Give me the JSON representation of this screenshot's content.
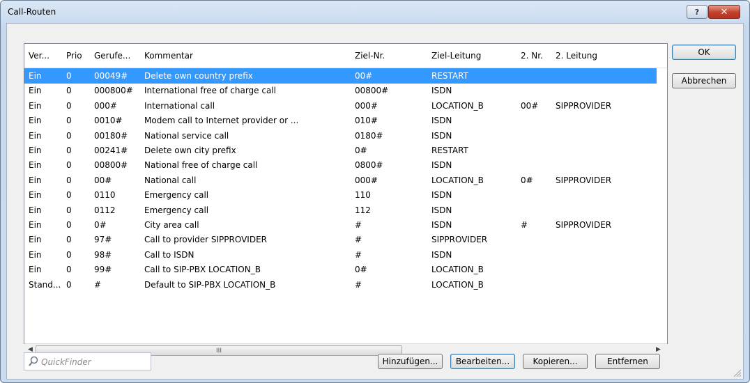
{
  "window": {
    "title": "Call-Routen",
    "help_label": "?",
    "close_label": "✕"
  },
  "columns": [
    "Ver...",
    "Prio",
    "Gerufe...",
    "Kommentar",
    "Ziel-Nr.",
    "Ziel-Leitung",
    "2. Nr.",
    "2. Leitung"
  ],
  "rows": [
    [
      "Ein",
      "0",
      "00049#",
      "Delete own country prefix",
      "00#",
      "RESTART",
      "",
      ""
    ],
    [
      "Ein",
      "0",
      "000800#",
      "International free of charge call",
      "00800#",
      "ISDN",
      "",
      ""
    ],
    [
      "Ein",
      "0",
      "000#",
      "International call",
      "000#",
      "LOCATION_B",
      "00#",
      "SIPPROVIDER"
    ],
    [
      "Ein",
      "0",
      "0010#",
      "Modem call to Internet provider or ...",
      "010#",
      "ISDN",
      "",
      ""
    ],
    [
      "Ein",
      "0",
      "00180#",
      "National service call",
      "0180#",
      "ISDN",
      "",
      ""
    ],
    [
      "Ein",
      "0",
      "00241#",
      "Delete own city prefix",
      "0#",
      "RESTART",
      "",
      ""
    ],
    [
      "Ein",
      "0",
      "00800#",
      "National free of charge call",
      "0800#",
      "ISDN",
      "",
      ""
    ],
    [
      "Ein",
      "0",
      "00#",
      "National call",
      "000#",
      "LOCATION_B",
      "0#",
      "SIPPROVIDER"
    ],
    [
      "Ein",
      "0",
      "0110",
      "Emergency call",
      "110",
      "ISDN",
      "",
      ""
    ],
    [
      "Ein",
      "0",
      "0112",
      "Emergency call",
      "112",
      "ISDN",
      "",
      ""
    ],
    [
      "Ein",
      "0",
      "0#",
      "City area call",
      "#",
      "ISDN",
      "#",
      "SIPPROVIDER"
    ],
    [
      "Ein",
      "0",
      "97#",
      "Call to provider SIPPROVIDER",
      "#",
      "SIPPROVIDER",
      "",
      ""
    ],
    [
      "Ein",
      "0",
      "98#",
      "Call to ISDN",
      "#",
      "ISDN",
      "",
      ""
    ],
    [
      "Ein",
      "0",
      "99#",
      "Call to SIP-PBX LOCATION_B",
      "0#",
      "LOCATION_B",
      "",
      ""
    ],
    [
      "Stand...",
      "0",
      "#",
      "Default to SIP-PBX LOCATION_B",
      "#",
      "LOCATION_B",
      "",
      ""
    ]
  ],
  "selected_row": 0,
  "scrollbar": {
    "thumb_label": "III"
  },
  "buttons": {
    "ok": "OK",
    "cancel": "Abbrechen",
    "add": "Hinzufügen...",
    "edit": "Bearbeiten...",
    "copy": "Kopieren...",
    "remove": "Entfernen"
  },
  "quickfinder": {
    "placeholder": "QuickFinder",
    "value": ""
  },
  "colors": {
    "selection": "#3399ff",
    "title_gradient": "#c6d8ee",
    "close": "#c0412c"
  }
}
